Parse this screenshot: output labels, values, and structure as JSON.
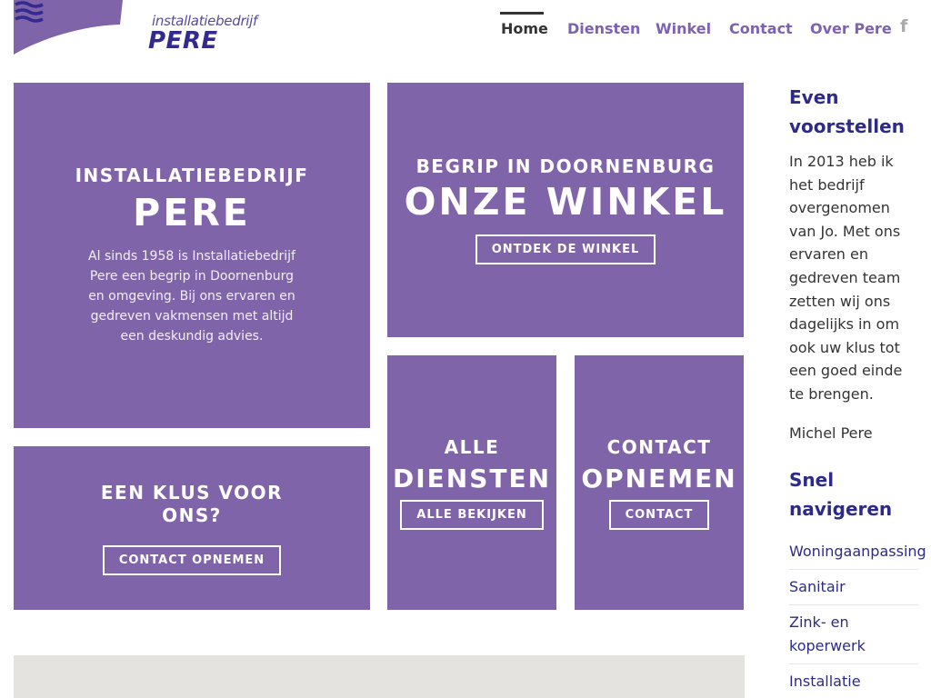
{
  "brand": {
    "tagline": "installatiebedrijf",
    "name": "PERE",
    "color": "#33298e",
    "swoosh_color": "#8064aa"
  },
  "nav": {
    "items": [
      {
        "label": "Home",
        "active": true
      },
      {
        "label": "Diensten",
        "active": false
      },
      {
        "label": "Winkel",
        "active": false
      },
      {
        "label": "Contact",
        "active": false
      },
      {
        "label": "Over Pere",
        "active": false
      }
    ],
    "social_icon": "facebook-icon",
    "social_glyph": "f"
  },
  "tiles": {
    "intro": {
      "kicker": "INSTALLATIEBEDRIJF",
      "title": "PERE",
      "description": "Al sinds 1958 is Installatiebedrijf Pere een begrip in Doornenburg en omgeving. Bij ons ervaren en gedreven vakmensen met altijd een deskundig advies."
    },
    "shop": {
      "kicker": "BEGRIP IN DOORNENBURG",
      "title": "ONZE WINKEL",
      "button": "ONTDEK DE WINKEL"
    },
    "job": {
      "title": "EEN KLUS VOOR ONS?",
      "button": "CONTACT OPNEMEN"
    },
    "services": {
      "kicker": "ALLE",
      "title": "DIENSTEN",
      "button": "ALLE BEKIJKEN"
    },
    "contact": {
      "kicker": "CONTACT",
      "title": "OPNEMEN",
      "button": "CONTACT"
    }
  },
  "sidebar": {
    "intro_heading": "Even voorstellen",
    "intro_text": "In 2013 heb ik het bedrijf overgenomen van Jo. Met ons ervaren en gedreven team zetten wij ons dagelijks in om ook uw klus tot een goed einde te brengen.",
    "signature": "Michel Pere",
    "nav_heading": "Snel navigeren",
    "links": [
      "Woningaanpassing",
      "Sanitair",
      "Zink- en koperwerk",
      "Installatie"
    ]
  },
  "colors": {
    "tile": "#8064aa",
    "nav_link": "#7d62b2",
    "heading": "#2e2a87"
  }
}
